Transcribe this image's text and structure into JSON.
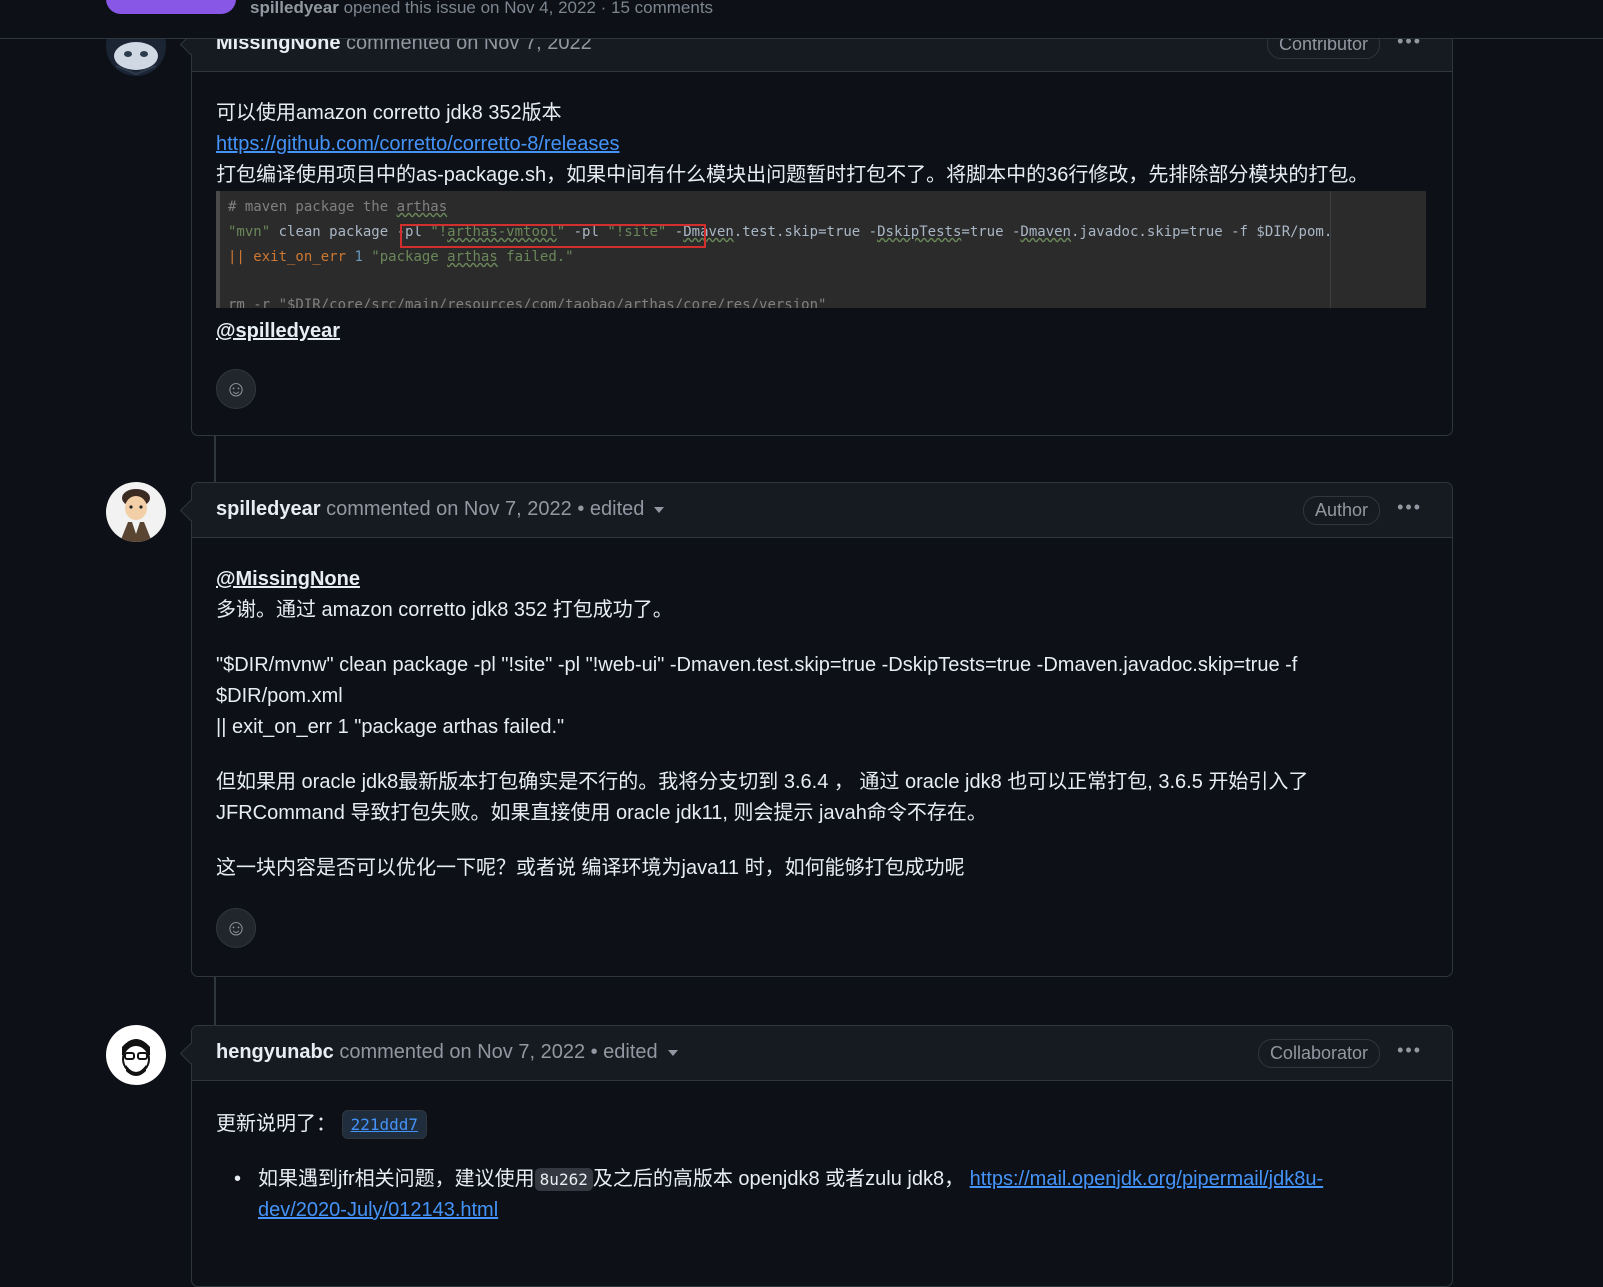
{
  "sticky_header": {
    "author": "spilledyear",
    "meta": "opened this issue on Nov 4, 2022 · 15 comments"
  },
  "comments": [
    {
      "author": "MissingNone",
      "action": "commented on Nov 7, 2022",
      "badge": "Contributor",
      "menu": "•••",
      "line1": "可以使用amazon corretto jdk8 352版本",
      "link": "https://github.com/corretto/corretto-8/releases",
      "line3": "打包编译使用项目中的as-package.sh，如果中间有什么模块出问题暂时打包不了。将脚本中的36行修改，先排除部分模块的打包。",
      "code": {
        "c1": "# maven package the ",
        "c1b": "arthas",
        "c2a": "\"mvn\"",
        "c2b": " clean package ",
        "c2c": "-pl ",
        "c2d": "\"!",
        "c2e": "arthas-vmtool",
        "c2f": "\"",
        "c2g": " -pl ",
        "c2h": "\"!site\"",
        "c2i": " -",
        "c2j": "Dmaven",
        "c2k": ".test.skip=true -",
        "c2l": "DskipTests",
        "c2m": "=true -",
        "c2n": "Dmaven",
        "c2o": ".javadoc.skip=true -f $DIR/pom.",
        "c3a": "|| exit_on_err ",
        "c3b": "1",
        "c3c": " \"package ",
        "c3d": "arthas",
        "c3e": " failed.\"",
        "c5": "rm -r \"$DIR/core/src/main/resources/com/taobao/arthas/core/res/version\""
      },
      "mention": "@spilledyear"
    },
    {
      "author": "spilledyear",
      "action": "commented on Nov 7, 2022 • edited",
      "badge": "Author",
      "menu": "•••",
      "mention": "@MissingNone",
      "thanks": "多谢。通过 amazon corretto jdk8 352 打包成功了。",
      "cmd1": "\"$DIR/mvnw\" clean package -pl \"!site\" -pl \"!web-ui\" -Dmaven.test.skip=true -DskipTests=true -Dmaven.javadoc.skip=true -f",
      "cmd2": "$DIR/pom.xml",
      "cmd3": "|| exit_on_err 1 \"package arthas failed.\"",
      "p3a": "但如果用 oracle jdk8最新版本打包确实是不行的。我将分支切到 3.6.4 ， 通过 oracle jdk8 也可以正常打包, 3.6.5 开始引入了",
      "p3b": "JFRCommand 导致打包失败。如果直接使用 oracle jdk11, 则会提示 javah命令不存在。",
      "p4": "这一块内容是否可以优化一下呢？或者说 编译环境为java11 时，如何能够打包成功呢"
    },
    {
      "author": "hengyunabc",
      "action": "commented on Nov 7, 2022 • edited",
      "badge": "Collaborator",
      "menu": "•••",
      "intro": "更新说明了：",
      "sha": "221ddd7",
      "bullet_a": "如果遇到jfr相关问题，建议使用",
      "bullet_code": "8u262",
      "bullet_b": "及之后的高版本 openjdk8 或者zulu jdk8，",
      "bullet_link1": "https://mail.openjdk.org/pipermail/jdk8u-",
      "bullet_link2": "dev/2020-July/012143.html"
    }
  ]
}
